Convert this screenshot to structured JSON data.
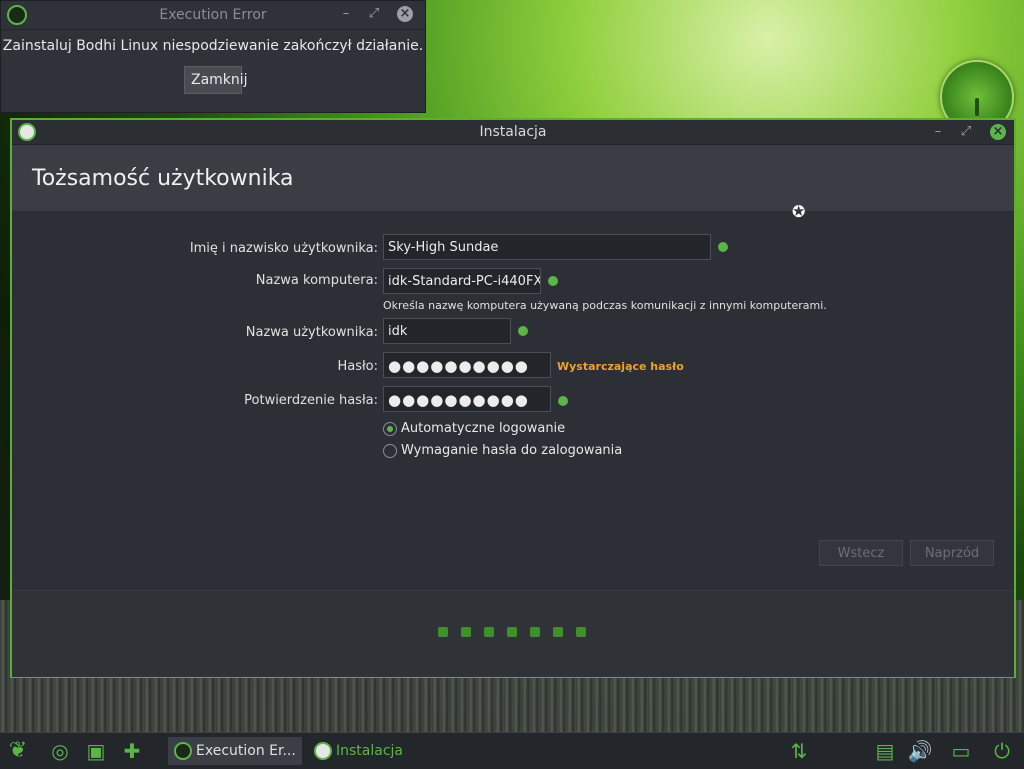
{
  "error_window": {
    "title": "Execution Error",
    "message": "Zainstaluj Bodhi Linux niespodziewanie zakończył działanie.",
    "button": "Zamknij"
  },
  "installer": {
    "title": "Instalacja",
    "heading": "Tożsamość użytkownika",
    "fields": {
      "full_name_label": "Imię i nazwisko użytkownika:",
      "full_name_value": "Sky-High Sundae",
      "computer_label": "Nazwa komputera:",
      "computer_value": "idk-Standard-PC-i440FX",
      "computer_hint": "Określa nazwę komputera używaną podczas komunikacji z innymi komputerami.",
      "username_label": "Nazwa użytkownika:",
      "username_value": "idk",
      "password_label": "Hasło:",
      "password_value": "●●●●●●●●●●",
      "password_strength": "Wystarczające hasło",
      "confirm_label": "Potwierdzenie hasła:",
      "confirm_value": "●●●●●●●●●●"
    },
    "login_options": {
      "auto_login": "Automatyczne logowanie",
      "require_password": "Wymaganie hasła do zalogowania",
      "selected": "auto_login"
    },
    "buttons": {
      "back": "Wstecz",
      "next": "Naprzód"
    },
    "progress_steps": 7
  },
  "taskbar": {
    "tasks": [
      {
        "label": "Execution Er...",
        "active": true
      },
      {
        "label": "Instalacja",
        "active": false
      }
    ]
  },
  "colors": {
    "accent": "#5cb548",
    "warning": "#f0a030",
    "window_bg": "#2c2f35"
  }
}
